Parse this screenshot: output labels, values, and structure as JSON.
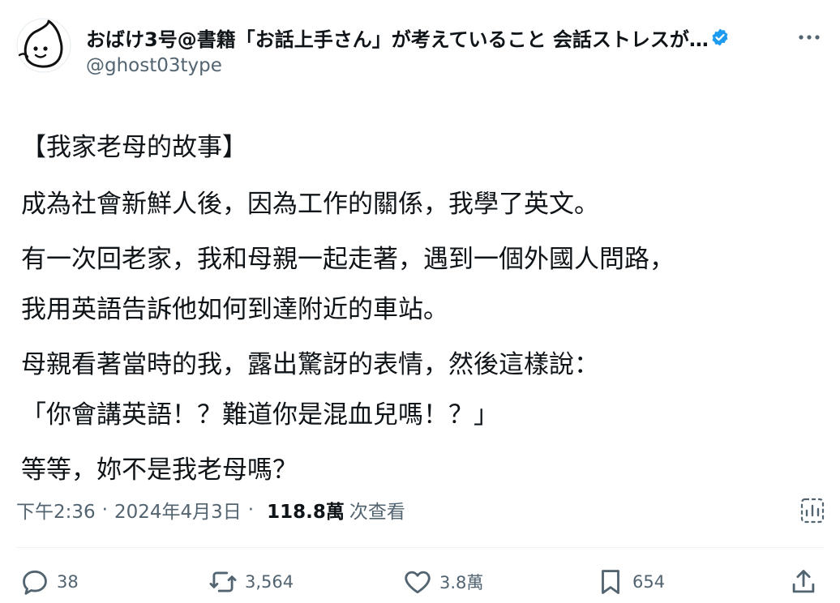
{
  "author": {
    "display_name": "おばけ3号@書籍「お話上手さん」が考えていること 会話ストレスが…",
    "handle": "@ghost03type",
    "verified": true,
    "avatar_icon": "ghost-avatar-icon"
  },
  "post": {
    "lines": [
      "【我家老母的故事】",
      "成為社會新鮮人後，因為工作的關係，我學了英文。",
      "有一次回老家，我和母親一起走著，遇到一個外國人問路，",
      "我用英語告訴他如何到達附近的車站。",
      "母親看著當時的我，露出驚訝的表情，然後這樣說：",
      "「你會講英語！？難道你是混血兒嗎！？」",
      "等等，妳不是我老母嗎？"
    ]
  },
  "meta": {
    "time": "下午2:36",
    "separator": "·",
    "date": "2024年4月3日",
    "views": "118.8萬",
    "views_label": "次查看"
  },
  "actions": {
    "reply_count": "38",
    "repost_count": "3,564",
    "like_count": "3.8萬",
    "bookmark_count": "654"
  },
  "colors": {
    "text": "#0f1419",
    "secondary": "#536471",
    "verified": "#1d9bf0",
    "divider": "#eff3f4"
  }
}
